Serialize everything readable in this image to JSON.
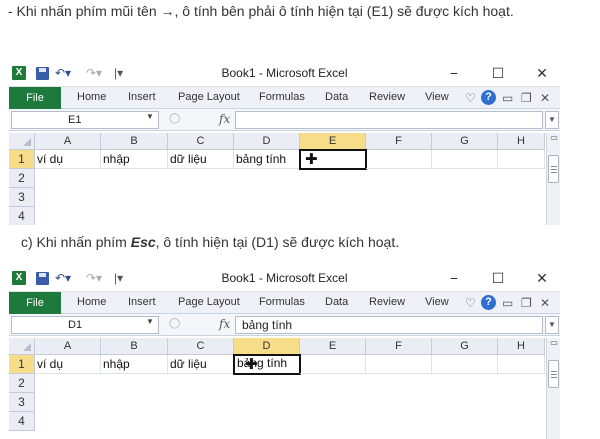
{
  "para1": {
    "text": "- Khi nhấn phím mũi tên →, ô tính bên phải ô tính hiện tại (E1) sẽ được kích hoạt."
  },
  "para2": {
    "before": "c) Khi nhấn phím ",
    "key": "Esc",
    "after": ", ô tính hiện tại (D1) sẽ được kích hoạt."
  },
  "excel": {
    "title": "Book1 - Microsoft Excel",
    "logo": "X",
    "window_buttons": [
      "−",
      "☐",
      "✕"
    ],
    "file_tab": "File",
    "menu": [
      "Home",
      "Insert",
      "Page Layout",
      "Formulas",
      "Data",
      "Review",
      "View"
    ],
    "fx": "fx",
    "columns": [
      "A",
      "B",
      "C",
      "D",
      "E",
      "F",
      "G",
      "H"
    ],
    "rows": [
      "1",
      "2",
      "3",
      "4"
    ],
    "row1": [
      "ví dụ",
      "nhập",
      "dữ liệu",
      "bảng tính"
    ]
  },
  "shot1": {
    "namebox": "E1",
    "formula": "",
    "active_column": "E"
  },
  "shot2": {
    "namebox": "D1",
    "formula": "bảng tính",
    "active_column": "D"
  },
  "icons": [
    "excel-logo-icon",
    "save-icon",
    "undo-icon",
    "redo-icon",
    "customize-arrow-icon",
    "minimize-icon",
    "maximize-icon",
    "close-icon",
    "help-icon",
    "fx-icon",
    "cell-cursor-icon"
  ]
}
